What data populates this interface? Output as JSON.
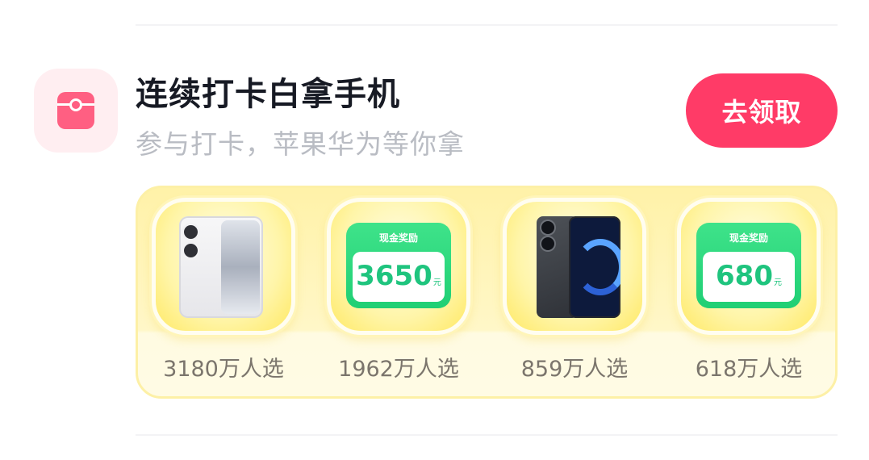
{
  "header": {
    "title": "连续打卡白拿手机",
    "subtitle": "参与打卡，苹果华为等你拿",
    "button_label": "去领取",
    "icon": "red-envelope-icon",
    "accent_color": "#ff3b67"
  },
  "rewards": [
    {
      "kind": "product",
      "image": "white-phone",
      "count": "3180万人选"
    },
    {
      "kind": "cash",
      "label": "现金奖励",
      "amount": "3650",
      "unit": "元",
      "count": "1962万人选"
    },
    {
      "kind": "product",
      "image": "dark-phone",
      "count": "859万人选"
    },
    {
      "kind": "cash",
      "label": "现金奖励",
      "amount": "680",
      "unit": "元",
      "count": "618万人选"
    }
  ]
}
